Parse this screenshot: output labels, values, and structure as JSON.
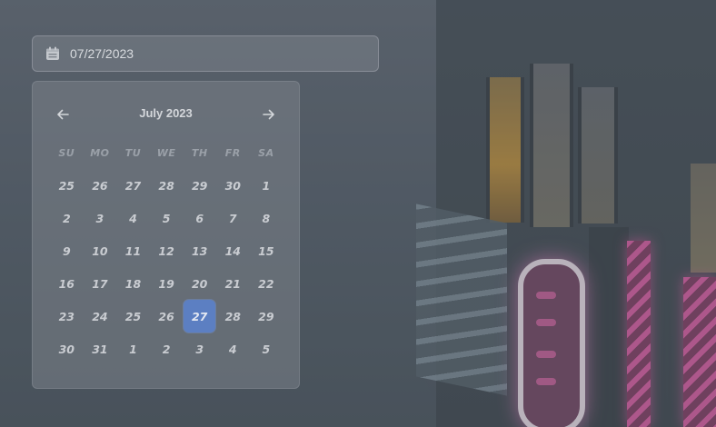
{
  "date_input": {
    "icon": "calendar-icon",
    "value": "07/27/2023"
  },
  "calendar": {
    "month_title": "July 2023",
    "prev_icon": "arrow-left-icon",
    "next_icon": "arrow-right-icon",
    "weekdays": [
      "SU",
      "MO",
      "TU",
      "WE",
      "TH",
      "FR",
      "SA"
    ],
    "weeks": [
      [
        "25",
        "26",
        "27",
        "28",
        "29",
        "30",
        "1"
      ],
      [
        "2",
        "3",
        "4",
        "5",
        "6",
        "7",
        "8"
      ],
      [
        "9",
        "10",
        "11",
        "12",
        "13",
        "14",
        "15"
      ],
      [
        "16",
        "17",
        "18",
        "19",
        "20",
        "21",
        "22"
      ],
      [
        "23",
        "24",
        "25",
        "26",
        "27",
        "28",
        "29"
      ],
      [
        "30",
        "31",
        "1",
        "2",
        "3",
        "4",
        "5"
      ]
    ],
    "selected_day": "27",
    "accent_color": "#5c7fc2"
  }
}
